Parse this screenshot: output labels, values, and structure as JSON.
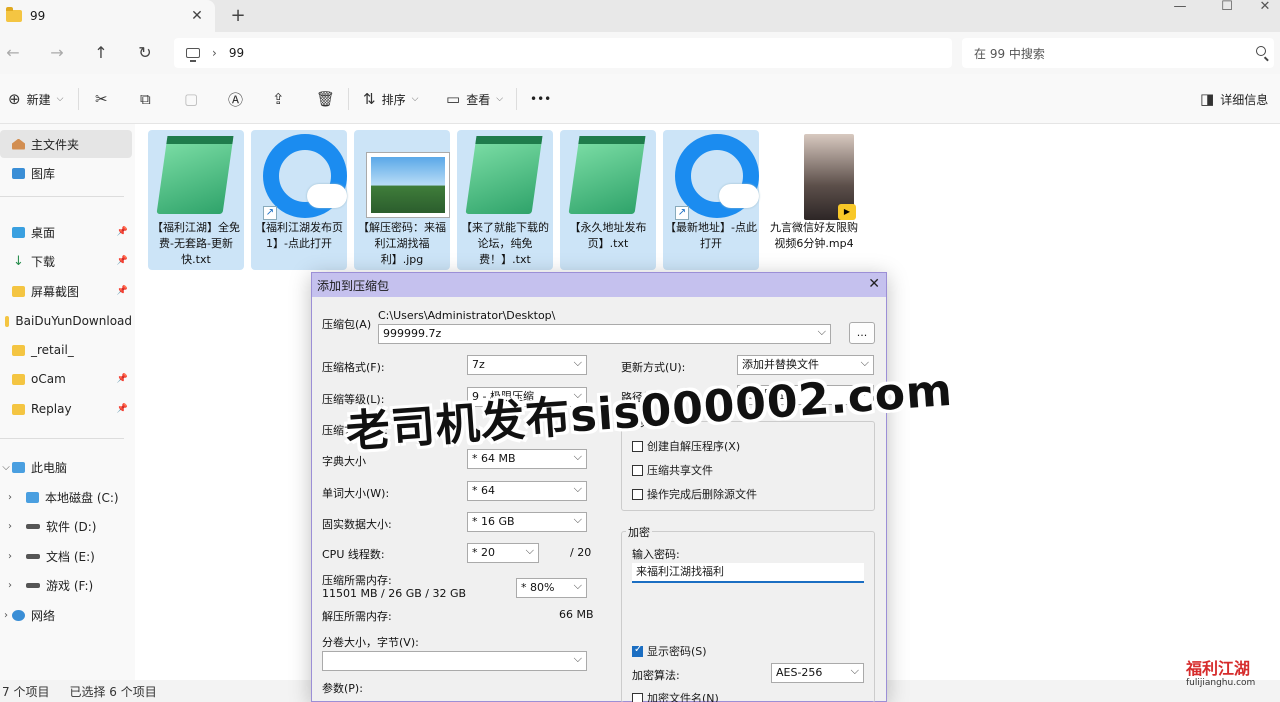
{
  "tab": {
    "title": "99",
    "close": "✕",
    "add": "+"
  },
  "window": {
    "minimize": "—",
    "maximize": "☐",
    "close": "✕"
  },
  "address": {
    "path": "99",
    "search_placeholder": "在 99 中搜索"
  },
  "commands": {
    "new": "新建",
    "sort": "排序",
    "view": "查看",
    "more": "•••",
    "details": "详细信息"
  },
  "sidebar": {
    "items": [
      "主文件夹",
      "图库",
      "桌面",
      "下载",
      "屏幕截图",
      "BaiDuYunDownload",
      "_retail_",
      "oCam",
      "Replay",
      "此电脑",
      "本地磁盘 (C:)",
      "软件 (D:)",
      "文档 (E:)",
      "游戏 (F:)",
      "网络"
    ]
  },
  "files": [
    {
      "name": "【福利江湖】全免费-无套路-更新快.txt",
      "type": "txt",
      "selected": true
    },
    {
      "name": "【福利江湖发布页1】-点此打开",
      "type": "browser",
      "selected": true
    },
    {
      "name": "【解压密码：来福利江湖找福利】.jpg",
      "type": "jpg",
      "selected": true
    },
    {
      "name": "【来了就能下载的论坛，纯免费！】.txt",
      "type": "txt",
      "selected": true
    },
    {
      "name": "【永久地址发布页】.txt",
      "type": "txt",
      "selected": true
    },
    {
      "name": "【最新地址】-点此打开",
      "type": "browser",
      "selected": true
    },
    {
      "name": "九言微信好友限购视频6分钟.mp4",
      "type": "video",
      "selected": false
    }
  ],
  "status": {
    "count": "7 个项目",
    "selected": "已选择 6 个项目"
  },
  "dialog": {
    "title": "添加到压缩包",
    "archive_label": "压缩包(A)",
    "archive_dir": "C:\\Users\\Administrator\\Desktop\\",
    "archive_name": "999999.7z",
    "browse": "...",
    "format_label": "压缩格式(F):",
    "format_value": "7z",
    "level_label": "压缩等级(L):",
    "level_value": "9 - 极限压缩",
    "method_label": "压缩方法(M):",
    "dict_label": "字典大小",
    "dict_value": "* 64 MB",
    "word_label": "单词大小(W):",
    "word_value": "* 64",
    "solid_label": "固实数据大小:",
    "solid_value": "* 16 GB",
    "cpu_label": "CPU 线程数:",
    "cpu_value": "* 20",
    "cpu_max": "/ 20",
    "mem_label": "压缩所需内存:",
    "mem_detail": "11501 MB / 26 GB / 32 GB",
    "mem_value": "* 80%",
    "demem_label": "解压所需内存:",
    "demem_value": "66 MB",
    "split_label": "分卷大小，字节(V):",
    "params_label": "参数(P):",
    "update_label": "更新方式(U):",
    "update_value": "添加并替换文件",
    "path_label": "路径模式",
    "path_value": "相对路径",
    "options_label": "选项",
    "opt_sfx": "创建自解压程序(X)",
    "opt_shared": "压缩共享文件",
    "opt_delete": "操作完成后删除源文件",
    "encrypt_label": "加密",
    "password_label": "输入密码:",
    "password_value": "来福利江湖找福利",
    "show_password": "显示密码(S)",
    "algo_label": "加密算法:",
    "algo_value": "AES-256",
    "encrypt_names": "加密文件名(N)"
  },
  "watermark": "老司机发布sis000002.com",
  "logo": {
    "main": "福利江湖",
    "sub": "fulijianghu.com"
  }
}
